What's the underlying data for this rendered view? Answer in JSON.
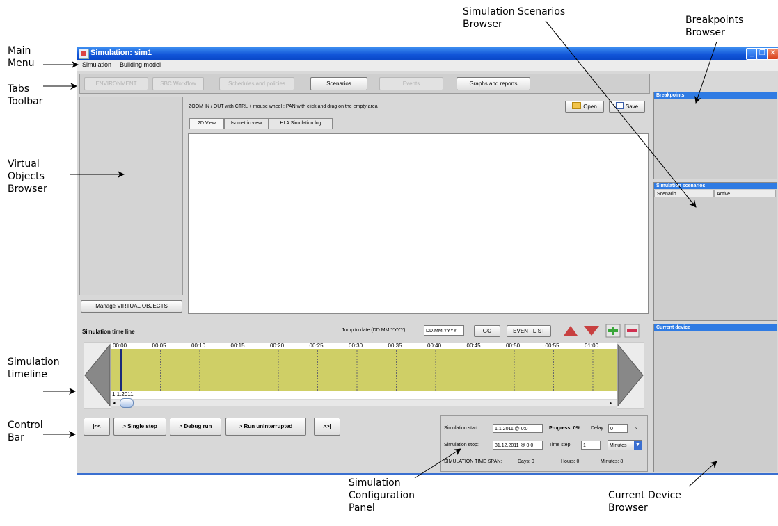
{
  "annotations": {
    "main_menu": "Main\nMenu",
    "tabs_toolbar": "Tabs\nToolbar",
    "virtual_objects": "Virtual\nObjects\nBrowser",
    "sim_timeline": "Simulation\ntimeline",
    "control_bar": "Control\nBar",
    "sim_config": "Simulation\nConfiguration\nPanel",
    "scenarios_browser": "Simulation Scenarios\nBrowser",
    "breakpoints_browser": "Breakpoints\nBrowser",
    "current_device": "Current Device\nBrowser"
  },
  "window": {
    "title": "Simulation: sim1",
    "minimize": "_",
    "restore": "❐",
    "close": "✕"
  },
  "menu": [
    "Simulation",
    "Building model"
  ],
  "tabs": [
    {
      "label": "ENVIRONMENT",
      "enabled": false
    },
    {
      "label": "SBC Workflow",
      "enabled": false
    },
    {
      "label": "Schedules and policies",
      "enabled": false
    },
    {
      "label": "Scenarios",
      "enabled": true
    },
    {
      "label": "Events",
      "enabled": false
    },
    {
      "label": "Graphs and reports",
      "enabled": true
    }
  ],
  "left_panel": {
    "manage_button": "Manage VIRTUAL OBJECTS"
  },
  "center": {
    "hint": "ZOOM IN / OUT with CTRL + mouse wheel ;  PAN with click and drag on the empty area",
    "open_label": "Open",
    "save_label": "Save",
    "view_tabs": [
      "2D View",
      "Isometric view",
      "HLA Simulation log"
    ]
  },
  "right": {
    "breakpoints_title": "Breakpoints",
    "scenarios_title": "Simulation scenarios",
    "scenarios_columns": [
      "Scenario",
      "Active"
    ],
    "current_device_title": "Current device"
  },
  "timeline": {
    "title": "Simulation time line",
    "jump_label": "Jump to date (DD.MM.YYYY):",
    "jump_placeholder": "DD.MM.YYYY",
    "go_label": "GO",
    "event_list_label": "EVENT LIST",
    "ticks": [
      "00:00",
      "00:05",
      "00:10",
      "00:15",
      "00:20",
      "00:25",
      "00:30",
      "00:35",
      "00:40",
      "00:45",
      "00:50",
      "00:55",
      "01:00"
    ],
    "date": "1.1.2011"
  },
  "controls": {
    "first": "|<<",
    "single_step": "> Single step",
    "debug_run": "> Debug run",
    "run_uninterrupted": "> Run uninterrupted",
    "last": ">>|"
  },
  "config": {
    "start_label": "Simulation start:",
    "start_value": "1.1.2011 @ 0:0",
    "progress_label": "Progress: 0%",
    "delay_label": "Delay:",
    "delay_value": "0",
    "delay_unit": "s",
    "stop_label": "Simulation stop:",
    "stop_value": "31.12.2011 @ 0:0",
    "time_step_label": "Time step:",
    "time_step_value": "1",
    "time_unit": "Minutes",
    "span_label": "SIMULATION TIME SPAN:",
    "days": "Days: 0",
    "hours": "Hours: 0",
    "minutes": "Minutes: 8"
  },
  "colors": {
    "title_blue": "#1154d8",
    "timeline_fill": "#cfcf66",
    "arrow_red": "#c84040",
    "plus_green": "#3aa63a",
    "minus_red": "#d03050"
  }
}
